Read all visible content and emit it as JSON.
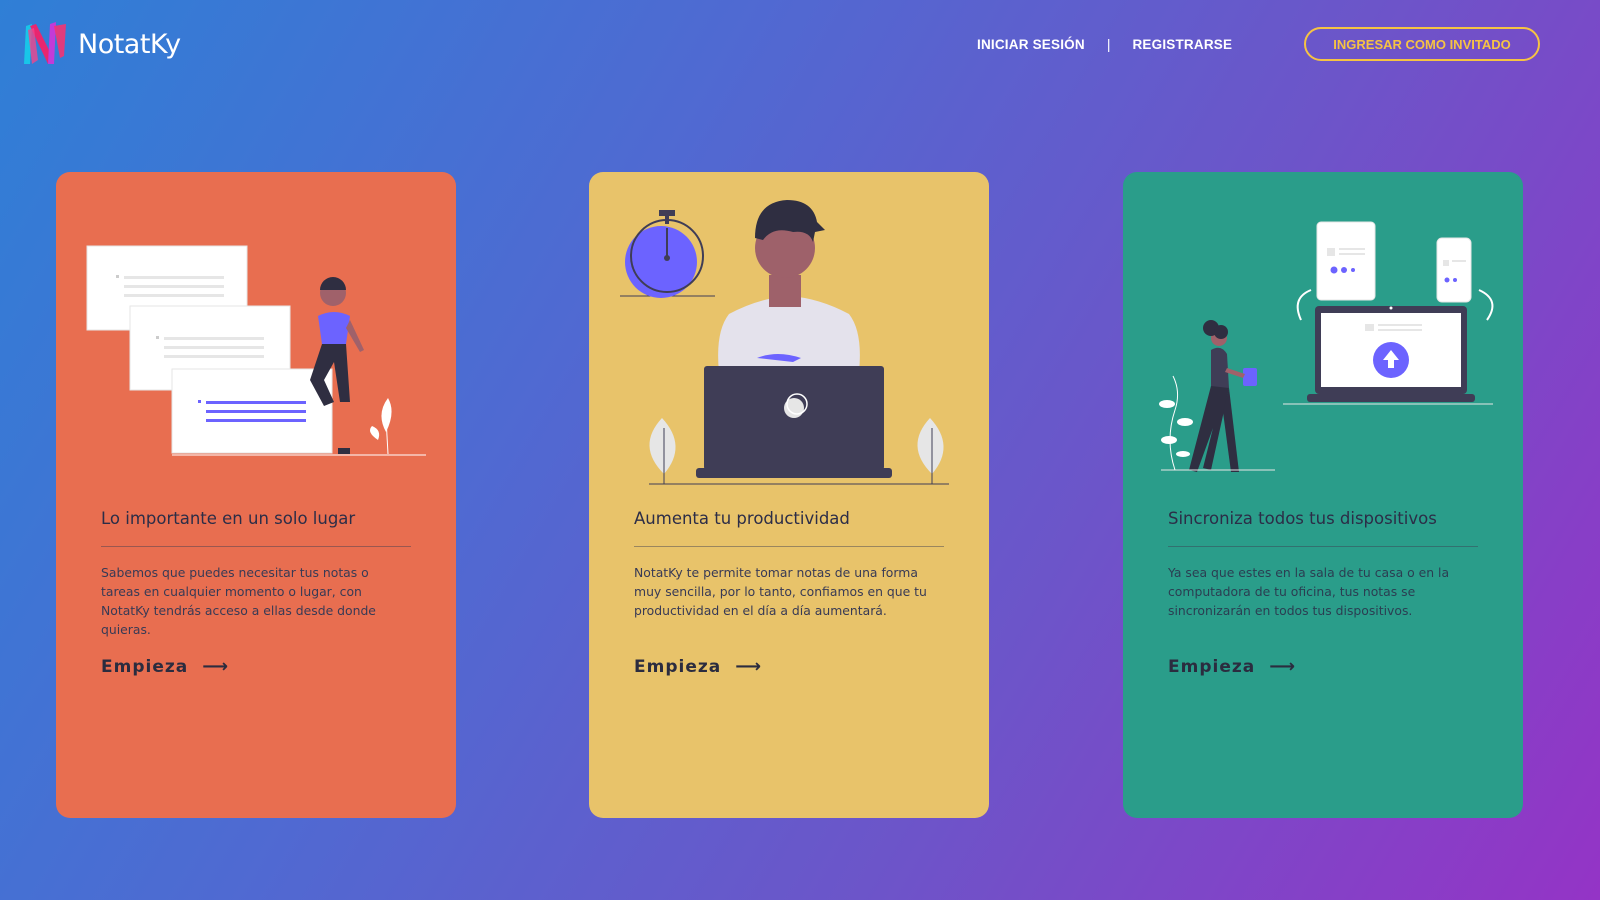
{
  "header": {
    "brand": "NotatKy",
    "nav": {
      "login": "INICIAR SESIÓN",
      "separator": "|",
      "register": "REGISTRARSE"
    },
    "guest_button": "INGRESAR COMO INVITADO"
  },
  "cards": [
    {
      "title": "Lo importante en un solo lugar",
      "description": "Sabemos que puedes necesitar tus notas o tareas en cualquier momento o lugar, con NotatKy tendrás acceso a ellas desde donde quieras.",
      "cta": "Empieza",
      "color": "#e86e50"
    },
    {
      "title": "Aumenta tu productividad",
      "description": "NotatKy te permite tomar notas de una forma muy sencilla, por lo tanto, confiamos en que tu productividad en el día a día aumentará.",
      "cta": "Empieza",
      "color": "#e8c36a"
    },
    {
      "title": "Sincroniza todos tus dispositivos",
      "description": "Ya sea que estes en la sala de tu casa o en la computadora de tu oficina, tus notas se sincronizarán en todos tus dispositivos.",
      "cta": "Empieza",
      "color": "#2a9d8a"
    }
  ],
  "colors": {
    "accent": "#f6c343",
    "illustration_purple": "#6c63ff",
    "dark": "#3f3d56"
  }
}
